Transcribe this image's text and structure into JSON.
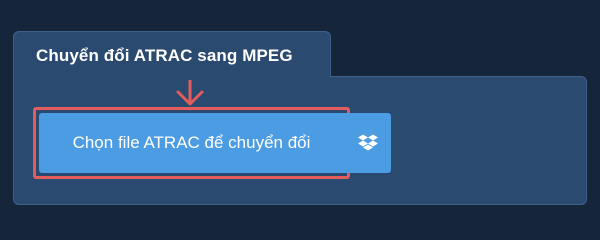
{
  "panel": {
    "tab_title": "Chuyển đổi ATRAC sang MPEG"
  },
  "upload": {
    "button_label": "Chọn file ATRAC để chuyển đổi",
    "dropbox_icon": "dropbox-icon",
    "arrow_icon": "arrow-down-icon"
  },
  "colors": {
    "background": "#15253a",
    "panel": "#2b4a70",
    "button": "#4c9ce4",
    "highlight": "#e35d5d"
  }
}
